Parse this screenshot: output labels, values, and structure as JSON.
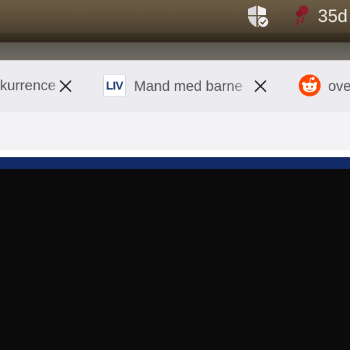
{
  "menubar": {
    "shield_icon": "shield-check-icon",
    "weather_icon": "weather-icon",
    "status_text": "35d"
  },
  "tabs": [
    {
      "title": "kurrence",
      "active": false,
      "favicon": "none"
    },
    {
      "title": "Mand med barne",
      "active": false,
      "favicon": "liv-logo"
    },
    {
      "title": "ove",
      "active": false,
      "favicon": "reddit-icon"
    }
  ],
  "favicon_liv_text": "LIV",
  "colors": {
    "tabstrip": "#ecebef",
    "tab_text": "#56555b",
    "navy_bar": "#132a68",
    "reddit_orange": "#ff4500",
    "content": "#0b0b0b"
  }
}
